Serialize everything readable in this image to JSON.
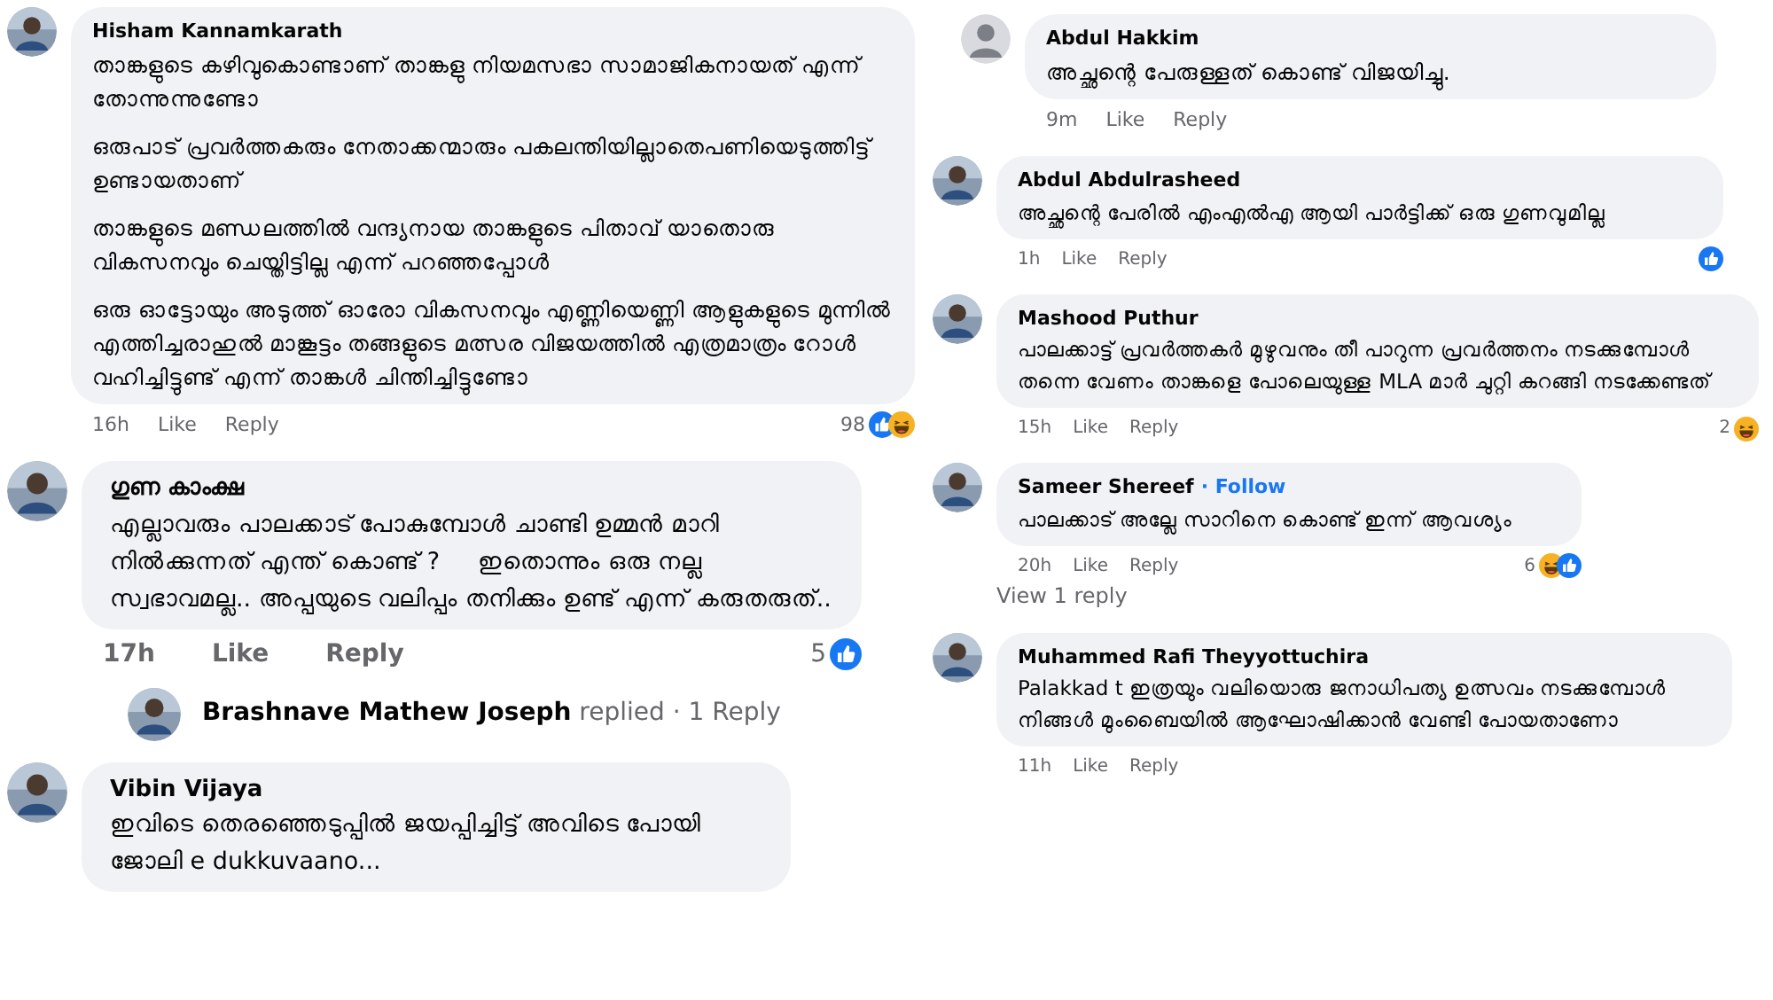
{
  "left_column": [
    {
      "kind": "comment",
      "author": "Hisham Kannamkarath",
      "paragraphs": [
        "താങ്കളുടെ കഴിവുകൊണ്ടാണ് താങ്കളു നിയമസഭാ സാമാജികനായത് എന്ന് തോന്നുന്നുണ്ടോ",
        "ഒരുപാട് പ്രവർത്തകരും നേതാക്കന്മാരും പകലന്തിയില്ലാതെപണിയെടുത്തിട്ട് ഉണ്ടായതാണ്",
        "താങ്കളുടെ മണ്ഡലത്തിൽ വന്ദ്യനായ താങ്കളുടെ പിതാവ് യാതൊരു വികസനവും ചെയ്തിട്ടില്ല എന്ന് പറഞ്ഞപ്പോൾ",
        "ഒരു ഓട്ടോയും അടുത്ത് ഓരോ വികസനവും എണ്ണിയെണ്ണി ആളുകളുടെ മുന്നിൽ എത്തിച്ചരാഹുൽ മാങ്കൂട്ടം തങ്ങളുടെ മത്സര വിജയത്തിൽ എത്രമാത്രം റോൾ വഹിച്ചിട്ടുണ്ട് എന്ന് താങ്കൾ ചിന്തിച്ചിട്ടുണ്ടോ"
      ],
      "time": "16h",
      "actions": [
        "Like",
        "Reply"
      ],
      "reaction_count": "98",
      "reactions": [
        {
          "kind": "like"
        },
        {
          "kind": "haha"
        }
      ]
    },
    {
      "kind": "comment",
      "author": "ഗുണ കാംക്ഷ",
      "paragraphs": [
        "എല്ലാവരും പാലക്കാട് പോകുമ്പോൾ ചാണ്ടി ഉമ്മൻ മാറി നിൽക്കുന്നത് എന്ത് കൊണ്ട് ?     ഇതൊന്നും ഒരു നല്ല സ്വഭാവമല്ല.. അപ്പയുടെ വലിപ്പം തനിക്കും ഉണ്ട് എന്ന് കരുതരുത്.."
      ],
      "time": "17h",
      "actions": [
        "Like",
        "Reply"
      ],
      "reaction_count": "5",
      "reactions": [
        {
          "kind": "like"
        }
      ]
    },
    {
      "kind": "replies_summary",
      "author": "Brashnave Mathew Joseph",
      "verb": "replied",
      "count": "· 1 Reply"
    },
    {
      "kind": "comment",
      "author": "Vibin Vijaya",
      "paragraphs": [
        "ഇവിടെ തെരഞ്ഞെടുപ്പിൽ ജയപ്പിച്ചിട്ട് അവിടെ പോയി ജോലി e dukkuvaano..."
      ]
    }
  ],
  "right_column": [
    {
      "kind": "comment",
      "author": "Abdul Hakkim",
      "paragraphs": [
        "അച്ഛന്റെ പേരുള്ളത് കൊണ്ട് വിജയിച്ചു."
      ],
      "time": "9m",
      "actions": [
        "Like",
        "Reply"
      ]
    },
    {
      "kind": "comment",
      "author": "Abdul Abdulrasheed",
      "paragraphs": [
        "അച്ഛന്റെ പേരിൽ എംഎൽഎ ആയി പാർട്ടിക്ക് ഒരു ഗുണവുമില്ല"
      ],
      "time": "1h",
      "actions": [
        "Like",
        "Reply"
      ],
      "reactions": [
        {
          "kind": "like"
        }
      ]
    },
    {
      "kind": "comment",
      "author": "Mashood Puthur",
      "paragraphs": [
        "പാലക്കാട്ട് പ്രവർത്തകർ മുഴുവനും തീ പാറുന്ന പ്രവർത്തനം നടക്കുമ്പോൾ തന്നെ വേണം താങ്കളെ പോലെയുള്ള MLA മാർ ചുറ്റി കറങ്ങി നടക്കേണ്ടത്"
      ],
      "time": "15h",
      "actions": [
        "Like",
        "Reply"
      ],
      "reaction_count": "2",
      "reactions": [
        {
          "kind": "haha"
        }
      ]
    },
    {
      "kind": "comment",
      "author": "Sameer Shereef",
      "follow": "· Follow",
      "paragraphs": [
        "പാലക്കാട് അല്ലേ സാറിനെ കൊണ്ട് ഇന്ന് ആവശ്യം"
      ],
      "time": "20h",
      "actions": [
        "Like",
        "Reply"
      ],
      "reaction_count": "6",
      "reactions": [
        {
          "kind": "haha"
        },
        {
          "kind": "like"
        }
      ]
    },
    {
      "kind": "view_replies",
      "label": "View 1 reply"
    },
    {
      "kind": "comment",
      "author": "Muhammed Rafi Theyyottuchira",
      "paragraphs": [
        "Palakkad t ഇത്രയും വലിയൊരു ജനാധിപത്യ ഉത്സവം നടക്കുമ്പോൾ നിങ്ങൾ മുംബൈയിൽ ആഘോഷിക്കാൻ വേണ്ടി പോയതാണോ"
      ],
      "time": "11h",
      "actions": [
        "Like",
        "Reply"
      ]
    }
  ]
}
